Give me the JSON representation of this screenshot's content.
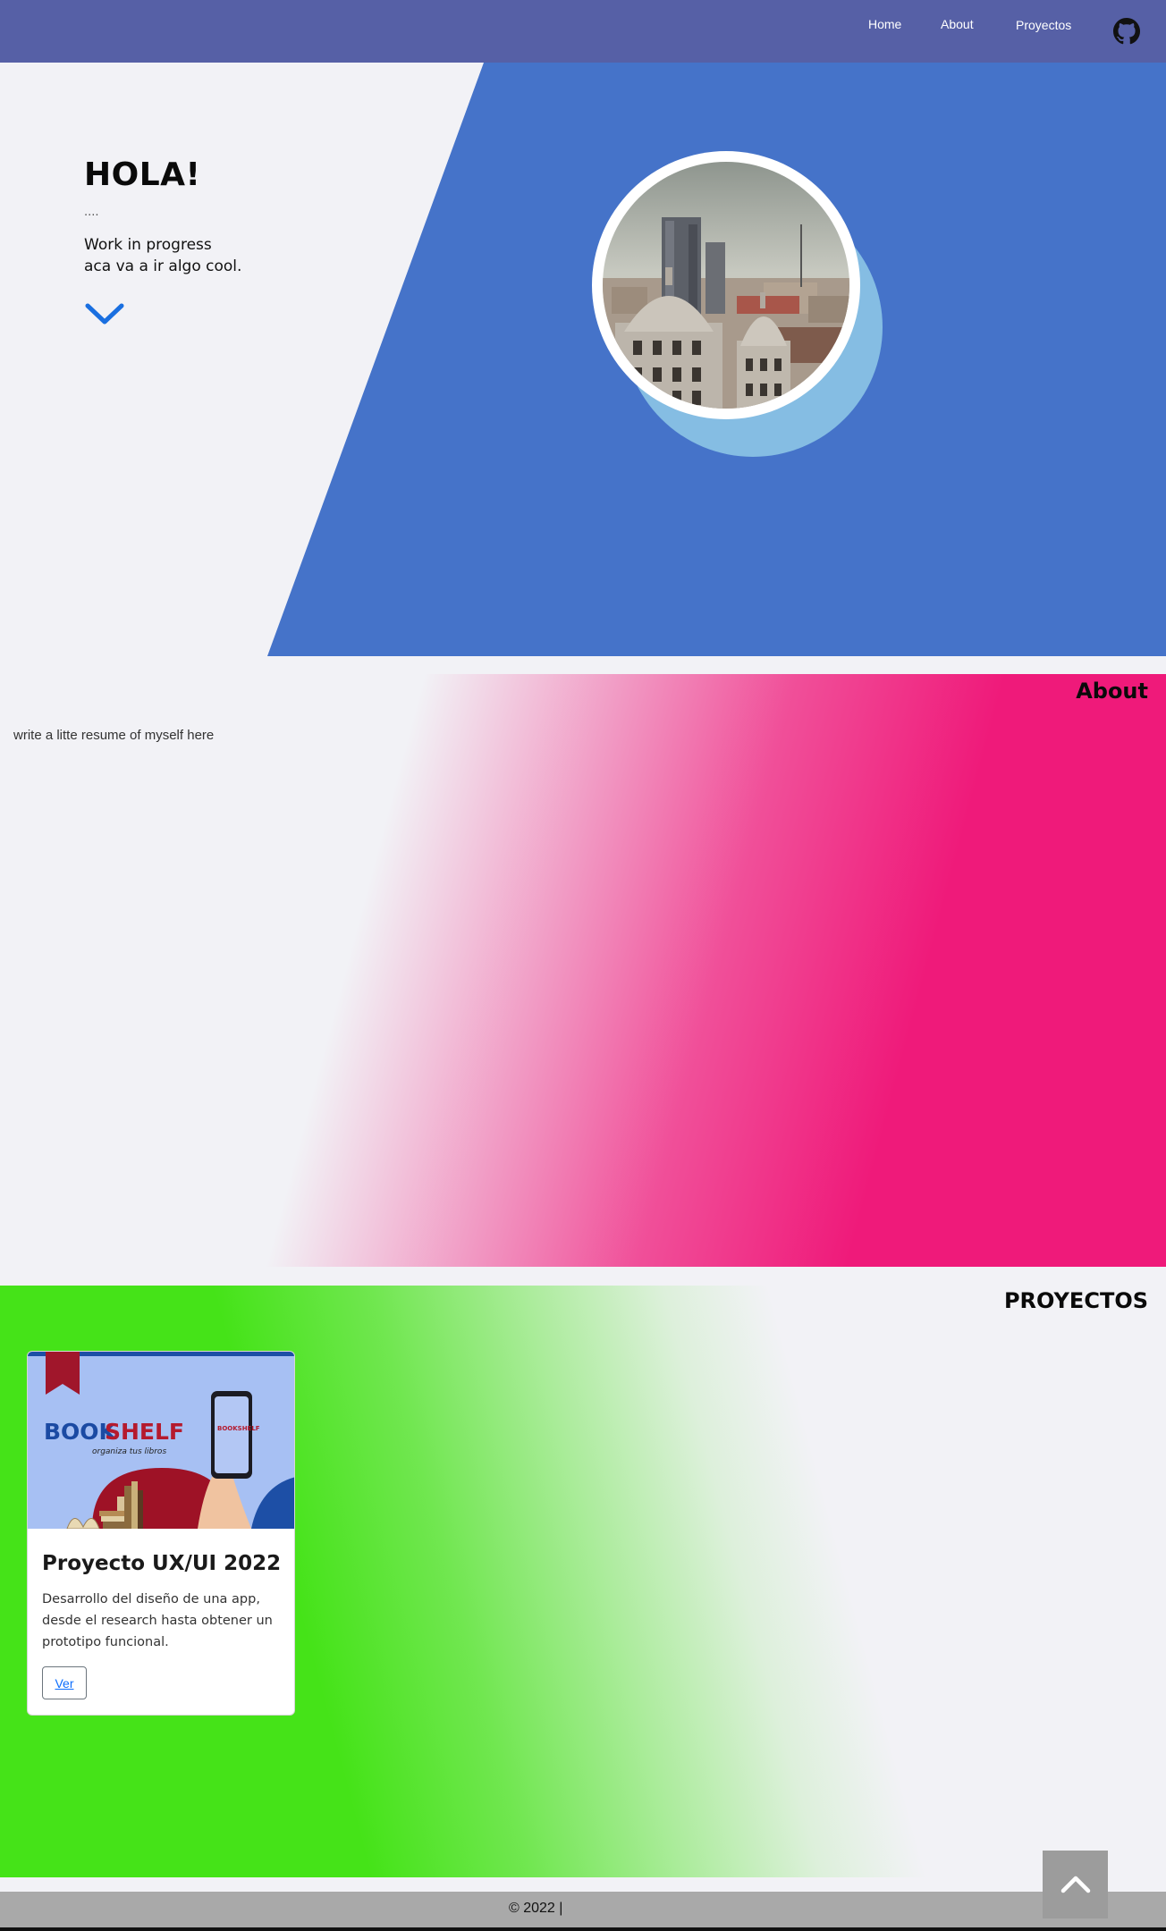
{
  "nav": {
    "items": [
      {
        "label": "Home"
      },
      {
        "label": "About"
      },
      {
        "label": "Proyectos"
      }
    ],
    "github_icon": "github-icon"
  },
  "hero": {
    "title": "HOLA!",
    "dots": "....",
    "line1": "Work in progress",
    "line2": "aca va a ir algo cool.",
    "scroll_icon": "chevron-down-icon",
    "photo": "city-skyline-photo",
    "colors": {
      "panel": "#4573c9",
      "ring": "#85bde3"
    }
  },
  "about": {
    "title": "About",
    "text": "write a litte resume of myself here",
    "accent": "#ef1a7a"
  },
  "projects": {
    "title": "PROYECTOS",
    "accent": "#45e318",
    "cards": [
      {
        "image_title": "BOOKSHELF",
        "image_title_a": "BOOK",
        "image_title_b": "SHELF",
        "image_subtitle": "organiza tus libros",
        "title": "Proyecto UX/UI 2022",
        "description": "Desarrollo del diseño de una app, desde el research hasta obtener un prototipo funcional.",
        "button": "Ver"
      }
    ]
  },
  "footer": {
    "text": "© 2022 |",
    "to_top_icon": "chevron-up-icon"
  }
}
